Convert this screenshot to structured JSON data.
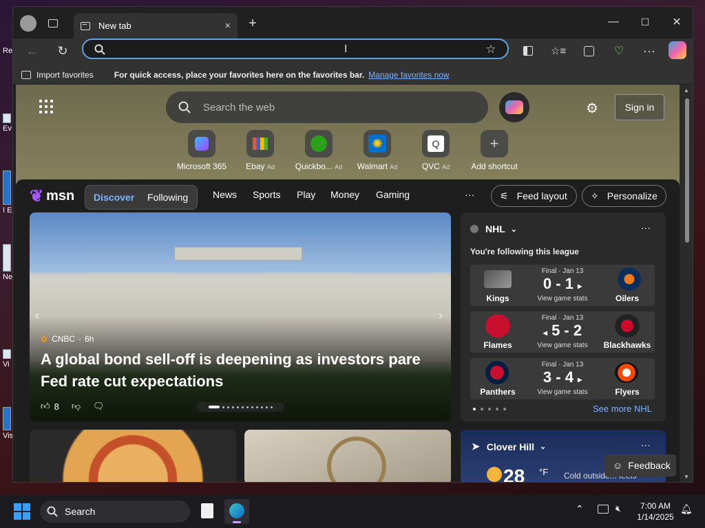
{
  "desktop": {
    "icons": [
      {
        "label": "Re"
      },
      {
        "label": "Ev"
      },
      {
        "label": "I E"
      },
      {
        "label": "Ne"
      },
      {
        "label": "Vi"
      },
      {
        "label": "Vis"
      }
    ]
  },
  "browser": {
    "tab": {
      "title": "New tab",
      "close": "×",
      "new": "+"
    },
    "window": {
      "minimize": "—",
      "maximize": "☐",
      "close": "✕"
    },
    "address": {
      "value": "",
      "placeholder": ""
    },
    "favorites_bar": {
      "import_label": "Import favorites",
      "hint": "For quick access, place your favorites here on the favorites bar.",
      "link": "Manage favorites now"
    }
  },
  "newtab": {
    "search_placeholder": "Search the web",
    "sign_in": "Sign in",
    "shortcuts": [
      {
        "label": "Microsoft 365",
        "ad": ""
      },
      {
        "label": "Ebay",
        "ad": "Ad"
      },
      {
        "label": "Quickbo...",
        "ad": "Ad"
      },
      {
        "label": "Walmart",
        "ad": "Ad"
      },
      {
        "label": "QVC",
        "ad": "Ad"
      },
      {
        "label": "Add shortcut",
        "ad": ""
      }
    ],
    "msn": {
      "brand": "msn",
      "tabs": [
        "Discover",
        "Following"
      ],
      "nav": [
        "News",
        "Sports",
        "Play",
        "Money",
        "Gaming"
      ],
      "more": "···",
      "feed_layout": "Feed layout",
      "personalize": "Personalize"
    },
    "hero": {
      "source": "CNBC",
      "age": "6h",
      "headline": "A global bond sell-off is deepening as investors pare Fed rate cut expectations",
      "likes": "8"
    },
    "nhl": {
      "title": "NHL",
      "following": "You're following this league",
      "see_more": "See more NHL",
      "games": [
        {
          "status": "Final · Jan 13",
          "score": "0 - 1",
          "winner": "right",
          "home": "Kings",
          "away": "Oilers",
          "stats": "View game stats"
        },
        {
          "status": "Final · Jan 13",
          "score": "5 - 2",
          "winner": "left",
          "home": "Flames",
          "away": "Blackhawks",
          "stats": "View game stats"
        },
        {
          "status": "Final · Jan 13",
          "score": "3 - 4",
          "winner": "right",
          "home": "Panthers",
          "away": "Flyers",
          "stats": "View game stats"
        }
      ]
    },
    "weather": {
      "location": "Clover Hill",
      "temp": "28",
      "unit": "°F",
      "note": "Cold outside... feels"
    },
    "feedback": "Feedback"
  },
  "taskbar": {
    "search": "Search",
    "time": "7:00 AM",
    "date": "1/14/2025"
  },
  "colors": {
    "accent": "#5fa3e6",
    "link": "#7fb2ff",
    "msn_pill": "#3a3a3a"
  }
}
